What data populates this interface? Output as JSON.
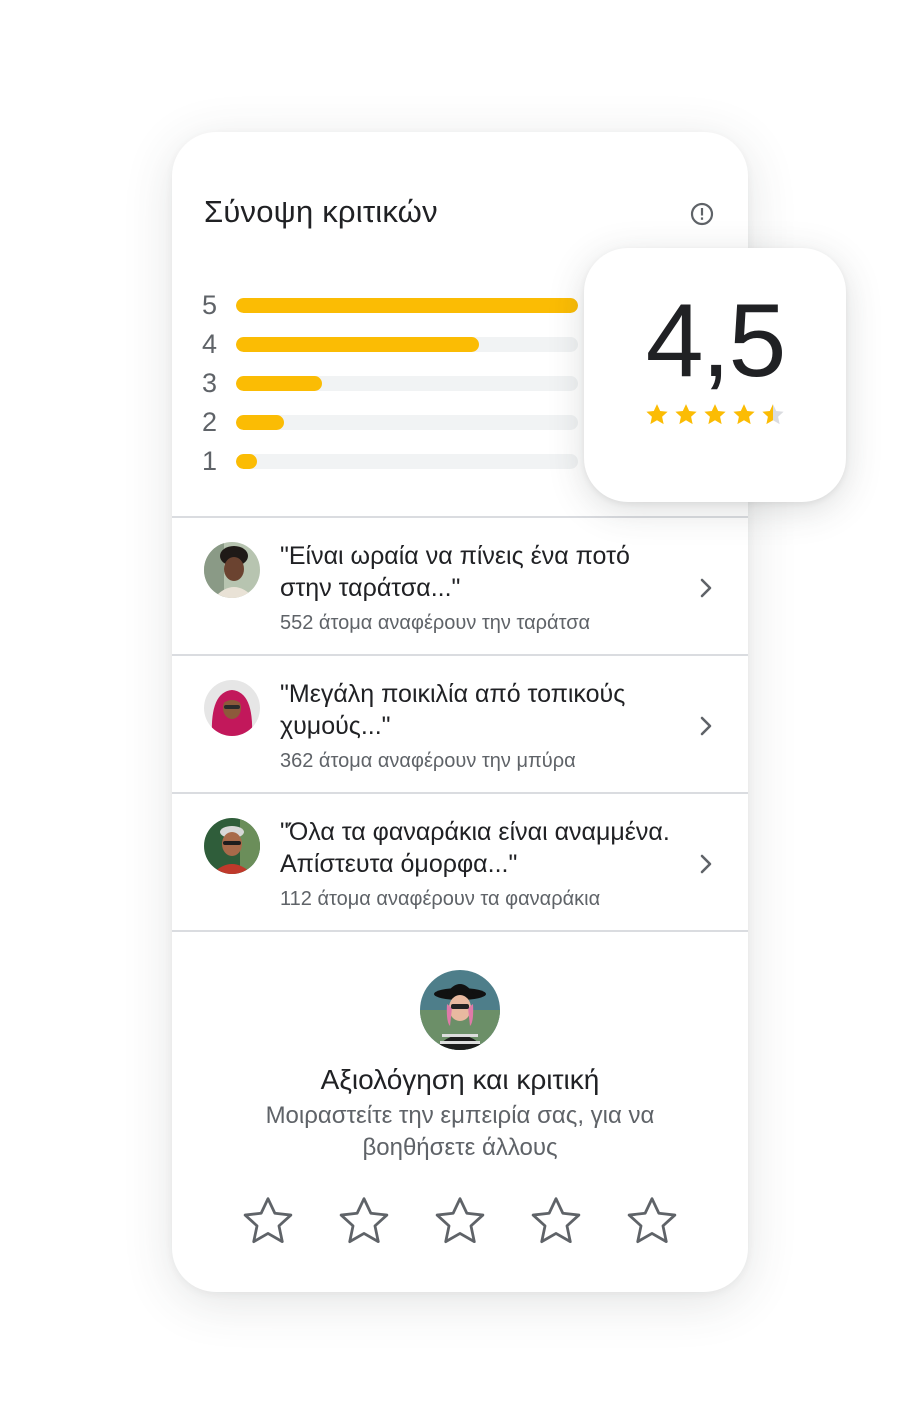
{
  "summary": {
    "title": "Σύνοψη κριτικών",
    "info_icon": "info-icon",
    "bars": [
      {
        "label": "5",
        "fraction": 1.0
      },
      {
        "label": "4",
        "fraction": 0.71
      },
      {
        "label": "3",
        "fraction": 0.25
      },
      {
        "label": "2",
        "fraction": 0.14
      },
      {
        "label": "1",
        "fraction": 0.06
      }
    ]
  },
  "rating": {
    "score": "4,5",
    "stars_value": 4.5,
    "stars_max": 5
  },
  "reviews": [
    {
      "quote": "\"Είναι ωραία να πίνεις ένα ποτό στην ταράτσα...\"",
      "mentions": "552 άτομα αναφέρουν την ταράτσα",
      "avatar": "reviewer-avatar"
    },
    {
      "quote": "\"Μεγάλη ποικιλία από τοπικούς χυμούς...\"",
      "mentions": "362 άτομα αναφέρουν την μπύρα",
      "avatar": "reviewer-avatar"
    },
    {
      "quote": "\"Όλα τα φαναράκια είναι αναμμένα. Απίστευτα όμορφα...\"",
      "mentions": "112 άτομα αναφέρουν τα φαναράκια",
      "avatar": "reviewer-avatar"
    }
  ],
  "write_review": {
    "title": "Αξιολόγηση και κριτική",
    "subtitle": "Μοιραστείτε την εμπειρία σας, για να βοηθήσετε άλλους",
    "star_count": 5
  },
  "colors": {
    "accent": "#fbbc04",
    "track": "#f1f3f4",
    "text": "#202124",
    "secondary": "#5f6368",
    "divider": "#dadce0",
    "empty_star_outline": "#5f6368"
  }
}
